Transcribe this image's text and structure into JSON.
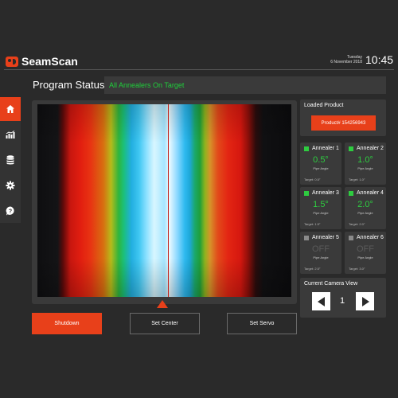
{
  "header": {
    "app_name": "SeamScan",
    "day": "Tuesday",
    "date": "6 November 2018",
    "time": "10:45"
  },
  "sidebar": {
    "items": [
      {
        "icon": "home-icon",
        "active": true
      },
      {
        "icon": "chart-icon",
        "active": false
      },
      {
        "icon": "database-icon",
        "active": false
      },
      {
        "icon": "gear-icon",
        "active": false
      },
      {
        "icon": "help-icon",
        "active": false
      }
    ]
  },
  "program": {
    "title": "Program Status",
    "status": "All Annealers On Target",
    "status_color": "#1fcf3a"
  },
  "buttons": {
    "shutdown": "Shutdown",
    "set_center": "Set Center",
    "set_servo": "Set Servo"
  },
  "loaded_product": {
    "title": "Loaded Product",
    "product": "Product# 154256943"
  },
  "annealers": [
    {
      "name": "Annealer 1",
      "value": "0.5°",
      "sub": "Pipe Angle",
      "target": "Target: 0.5°",
      "on": true
    },
    {
      "name": "Annealer 2",
      "value": "1.0°",
      "sub": "Pipe Angle",
      "target": "Target: 1.0°",
      "on": true
    },
    {
      "name": "Annealer 3",
      "value": "1.5°",
      "sub": "Pipe Angle",
      "target": "Target: 1.5°",
      "on": true
    },
    {
      "name": "Annealer 4",
      "value": "2.0°",
      "sub": "Pipe Angle",
      "target": "Target: 2.0°",
      "on": true
    },
    {
      "name": "Annealer 5",
      "value": "OFF",
      "sub": "Pipe Angle",
      "target": "Target: 2.5°",
      "on": false
    },
    {
      "name": "Annealer 6",
      "value": "OFF",
      "sub": "Pipe Angle",
      "target": "Target: 3.0°",
      "on": false
    }
  ],
  "camera_view": {
    "title": "Current Camera View",
    "number": "1"
  },
  "colors": {
    "accent": "#e8401a",
    "ok": "#2ecc40",
    "off": "#8a8a8a"
  }
}
